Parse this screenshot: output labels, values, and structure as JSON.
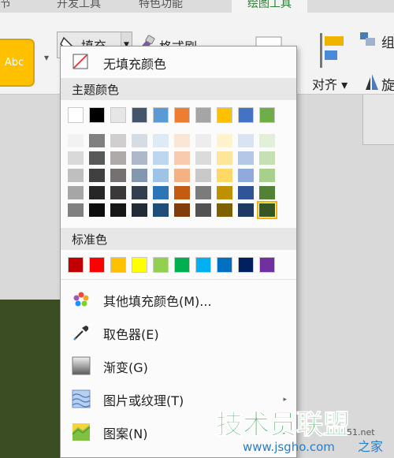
{
  "tabs": [
    {
      "label": "节",
      "active": false
    },
    {
      "label": "开发工具",
      "active": false
    },
    {
      "label": "特色功能",
      "active": false
    },
    {
      "label": "绘图工具",
      "active": true
    }
  ],
  "ribbon": {
    "style_swatch_label": "Abc",
    "fill_label": "填充",
    "painter_label": "格式刷",
    "align_label": "对齐",
    "truncated_label": "组",
    "truncated_label2": "旋"
  },
  "menu": {
    "no_fill": "无填充颜色",
    "theme_colors_header": "主题颜色",
    "standard_colors_header": "标准色",
    "more_colors": "其他填充颜色(M)...",
    "eyedropper": "取色器(E)",
    "gradient": "渐变(G)",
    "picture_texture": "图片或纹理(T)",
    "pattern": "图案(N)"
  },
  "theme_colors": {
    "base": [
      "#ffffff",
      "#000000",
      "#e7e6e6",
      "#44546a",
      "#5b9bd5",
      "#ed7d31",
      "#a5a5a5",
      "#ffc000",
      "#4472c4",
      "#70ad47"
    ],
    "shades": [
      [
        "#f2f2f2",
        "#d9d9d9",
        "#bfbfbf",
        "#a6a6a6",
        "#808080"
      ],
      [
        "#808080",
        "#595959",
        "#404040",
        "#262626",
        "#0d0d0d"
      ],
      [
        "#d0cece",
        "#aeaaaa",
        "#757171",
        "#3a3838",
        "#171616"
      ],
      [
        "#d6dce4",
        "#adb9ca",
        "#8497b0",
        "#333f4f",
        "#222a35"
      ],
      [
        "#deebf6",
        "#bdd7ee",
        "#9dc3e6",
        "#2e75b5",
        "#1f4e79"
      ],
      [
        "#fbe5d5",
        "#f7cbac",
        "#f4b183",
        "#c55a11",
        "#833c0b"
      ],
      [
        "#ededed",
        "#dbdbdb",
        "#c9c9c9",
        "#7b7b7b",
        "#525252"
      ],
      [
        "#fff2cc",
        "#fee599",
        "#ffd965",
        "#bf9000",
        "#7f6000"
      ],
      [
        "#dae3f3",
        "#b4c7e7",
        "#8faadc",
        "#2f5597",
        "#203864"
      ],
      [
        "#e2efd9",
        "#c5e0b3",
        "#a8d08d",
        "#538135",
        "#375623"
      ]
    ],
    "selected": {
      "column": 9,
      "row": 4
    }
  },
  "standard_colors": [
    "#c00000",
    "#ff0000",
    "#ffc000",
    "#ffff00",
    "#92d050",
    "#00b050",
    "#00b0f0",
    "#0070c0",
    "#002060",
    "#7030a0"
  ],
  "icons": {
    "no_fill": "no-fill-icon",
    "more_colors": "color-wheel-icon",
    "eyedropper": "eyedropper-icon",
    "gradient": "gradient-icon",
    "picture_texture": "texture-icon",
    "pattern": "pattern-icon"
  },
  "watermark": {
    "brand": "技术员联盟",
    "url": "www.jsgho.com",
    "url_partial": "51.net",
    "suffix": "之家"
  }
}
